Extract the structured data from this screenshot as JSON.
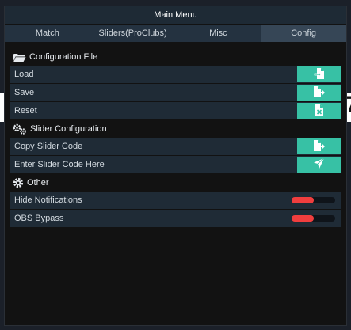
{
  "app": {
    "title": "Main Menu"
  },
  "tabs": [
    {
      "label": "Match"
    },
    {
      "label": "Sliders(ProClubs)"
    },
    {
      "label": "Misc"
    },
    {
      "label": "Config",
      "active": true
    }
  ],
  "sections": {
    "config_file": {
      "title": "Configuration File",
      "icon": "folder-open-icon",
      "items": [
        {
          "label": "Load",
          "icon": "file-import-icon"
        },
        {
          "label": "Save",
          "icon": "file-export-icon"
        },
        {
          "label": "Reset",
          "icon": "file-excel-icon"
        }
      ]
    },
    "slider_config": {
      "title": "Slider Configuration",
      "icon": "cogs-icon",
      "items": [
        {
          "label": "Copy Slider Code",
          "icon": "file-export-icon"
        },
        {
          "label": "Enter Slider Code Here",
          "icon": "paper-plane-icon"
        }
      ]
    },
    "other": {
      "title": "Other",
      "icon": "gear-icon",
      "items": [
        {
          "label": "Hide Notifications",
          "value": 0.5
        },
        {
          "label": "OBS Bypass",
          "value": 0.5
        }
      ]
    }
  },
  "colors": {
    "accent": "#37c1a5",
    "toggle_on": "#f03e3e",
    "row_bg": "#1f2b36",
    "title_bg": "#1e2a35"
  }
}
